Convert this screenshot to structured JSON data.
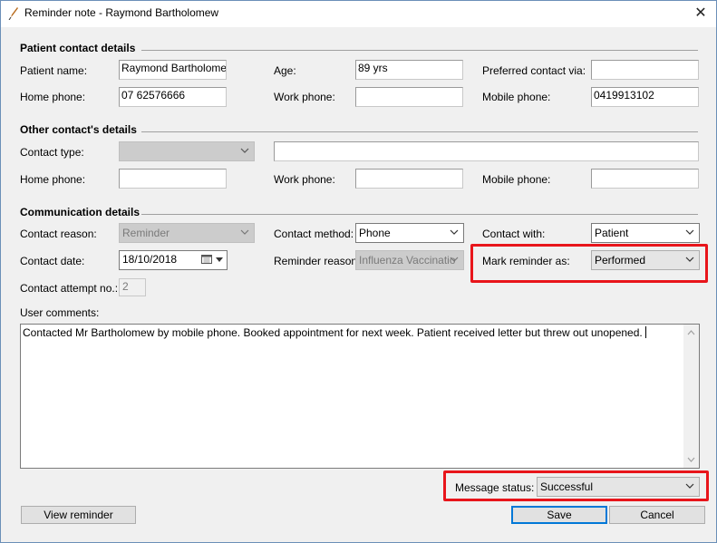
{
  "window": {
    "title": "Reminder note - Raymond Bartholomew",
    "close_glyph": "✕"
  },
  "patient_section": {
    "heading": "Patient contact details",
    "name_label": "Patient name:",
    "name_value": "Raymond Bartholomew",
    "age_label": "Age:",
    "age_value": "89 yrs",
    "preferred_label": "Preferred contact via:",
    "preferred_value": "",
    "home_label": "Home phone:",
    "home_value": "07 62576666",
    "work_label": "Work phone:",
    "work_value": "",
    "mobile_label": "Mobile phone:",
    "mobile_value": "0419913102"
  },
  "other_section": {
    "heading": "Other contact's details",
    "type_label": "Contact type:",
    "type_value": "",
    "type_text": "",
    "home_label": "Home phone:",
    "home_value": "",
    "work_label": "Work phone:",
    "work_value": "",
    "mobile_label": "Mobile phone:",
    "mobile_value": ""
  },
  "comm_section": {
    "heading": "Communication details",
    "reason_label": "Contact reason:",
    "reason_value": "Reminder",
    "method_label": "Contact method:",
    "method_value": "Phone",
    "with_label": "Contact with:",
    "with_value": "Patient",
    "date_label": "Contact date:",
    "date_value": "18/10/2018",
    "reminder_reason_label": "Reminder reason:",
    "reminder_reason_value": "Influenza Vaccinatio",
    "mark_label": "Mark reminder as:",
    "mark_value": "Performed",
    "attempt_label": "Contact attempt no.:",
    "attempt_value": "2",
    "comments_label": "User comments:",
    "comments_value": "Contacted Mr Bartholomew by mobile phone. Booked appointment for next week. Patient received letter but threw out unopened."
  },
  "status": {
    "label": "Message status:",
    "value": "Successful"
  },
  "buttons": {
    "view_reminder": "View reminder",
    "save": "Save",
    "cancel": "Cancel"
  },
  "colors": {
    "highlight": "#e8151b",
    "default_button": "#0078d7"
  }
}
